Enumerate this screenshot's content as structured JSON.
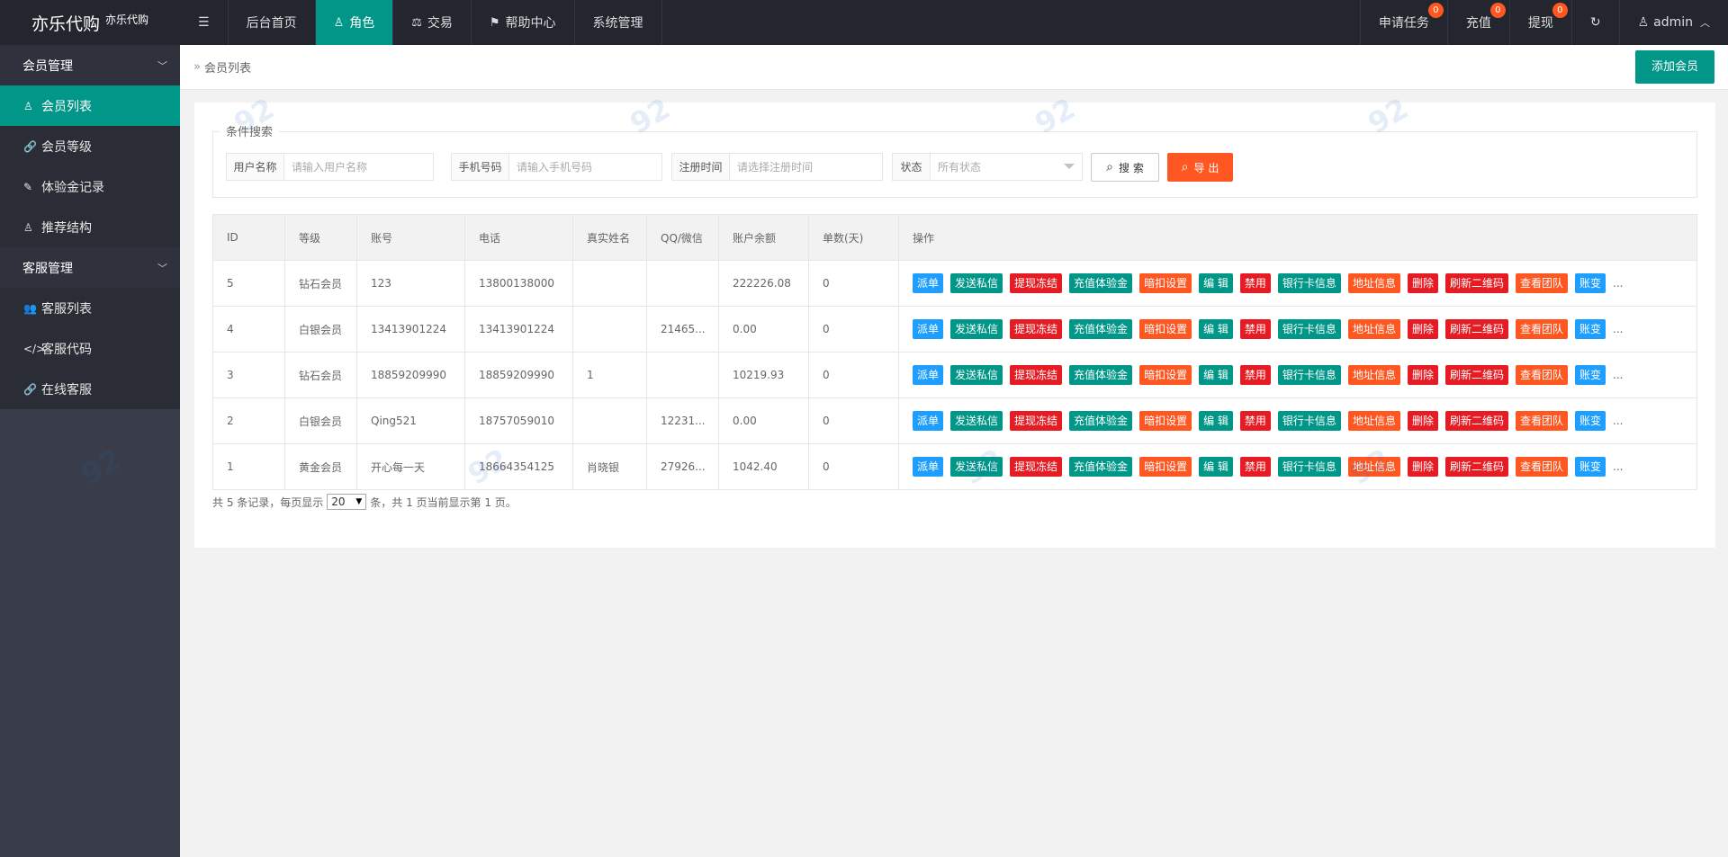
{
  "app": {
    "title": "亦乐代购",
    "subtitle": "亦乐代购"
  },
  "topnav": {
    "toggle_icon": "menu-toggle-icon",
    "items": [
      {
        "label": "后台首页",
        "icon": ""
      },
      {
        "label": "角色",
        "icon": "user-icon"
      },
      {
        "label": "交易",
        "icon": "scale-icon"
      },
      {
        "label": "帮助中心",
        "icon": "flag-icon"
      },
      {
        "label": "系统管理",
        "icon": ""
      }
    ],
    "right": [
      {
        "label": "申请任务",
        "badge": "0"
      },
      {
        "label": "充值",
        "badge": "0"
      },
      {
        "label": "提现",
        "badge": "0"
      }
    ],
    "user": "admin"
  },
  "sidebar": {
    "groups": [
      {
        "label": "会员管理",
        "items": [
          "会员列表",
          "会员等级",
          "体验金记录",
          "推荐结构"
        ]
      },
      {
        "label": "客服管理",
        "items": [
          "客服列表",
          "客服代码",
          "在线客服"
        ]
      }
    ]
  },
  "breadcrumb": "会员列表",
  "add_button": "添加会员",
  "search": {
    "legend": "条件搜索",
    "username": {
      "label": "用户名称",
      "placeholder": "请输入用户名称"
    },
    "phone": {
      "label": "手机号码",
      "placeholder": "请输入手机号码"
    },
    "regtime": {
      "label": "注册时间",
      "placeholder": "请选择注册时间"
    },
    "status": {
      "label": "状态",
      "value": "所有状态"
    },
    "search_btn": "搜 索",
    "export_btn": "导 出"
  },
  "table": {
    "headers": [
      "ID",
      "等级",
      "账号",
      "电话",
      "真实姓名",
      "QQ/微信",
      "账户余额",
      "单数(天)",
      "操作"
    ],
    "rows": [
      [
        "5",
        "钻石会员",
        "123",
        "13800138000",
        "",
        "",
        "222226.08",
        "0"
      ],
      [
        "4",
        "白银会员",
        "13413901224",
        "13413901224",
        "",
        "21465...",
        "0.00",
        "0"
      ],
      [
        "3",
        "钻石会员",
        "18859209990",
        "18859209990",
        "1",
        "",
        "10219.93",
        "0"
      ],
      [
        "2",
        "白银会员",
        "Qing521",
        "18757059010",
        "",
        "12231...",
        "0.00",
        "0"
      ],
      [
        "1",
        "黄金会员",
        "开心每一天",
        "18664354125",
        "肖晓银",
        "27926...",
        "1042.40",
        "0"
      ]
    ],
    "actions": [
      {
        "label": "派单",
        "color": "#1e9fff"
      },
      {
        "label": "发送私信",
        "color": "#009688"
      },
      {
        "label": "提现冻结",
        "color": "#e51c23"
      },
      {
        "label": "充值体验金",
        "color": "#009688"
      },
      {
        "label": "暗扣设置",
        "color": "#ff5722"
      },
      {
        "label": "编 辑",
        "color": "#009688"
      },
      {
        "label": "禁用",
        "color": "#e51c23"
      },
      {
        "label": "银行卡信息",
        "color": "#009688"
      },
      {
        "label": "地址信息",
        "color": "#ff5722"
      },
      {
        "label": "删除",
        "color": "#e51c23"
      },
      {
        "label": "刷新二维码",
        "color": "#e51c23"
      },
      {
        "label": "查看团队",
        "color": "#ff5722"
      },
      {
        "label": "账变",
        "color": "#1e9fff"
      }
    ],
    "more": "..."
  },
  "pager": {
    "prefix": "共 5 条记录，每页显示",
    "per_page": "20",
    "suffix": "条，共 1 页当前显示第 1 页。"
  }
}
